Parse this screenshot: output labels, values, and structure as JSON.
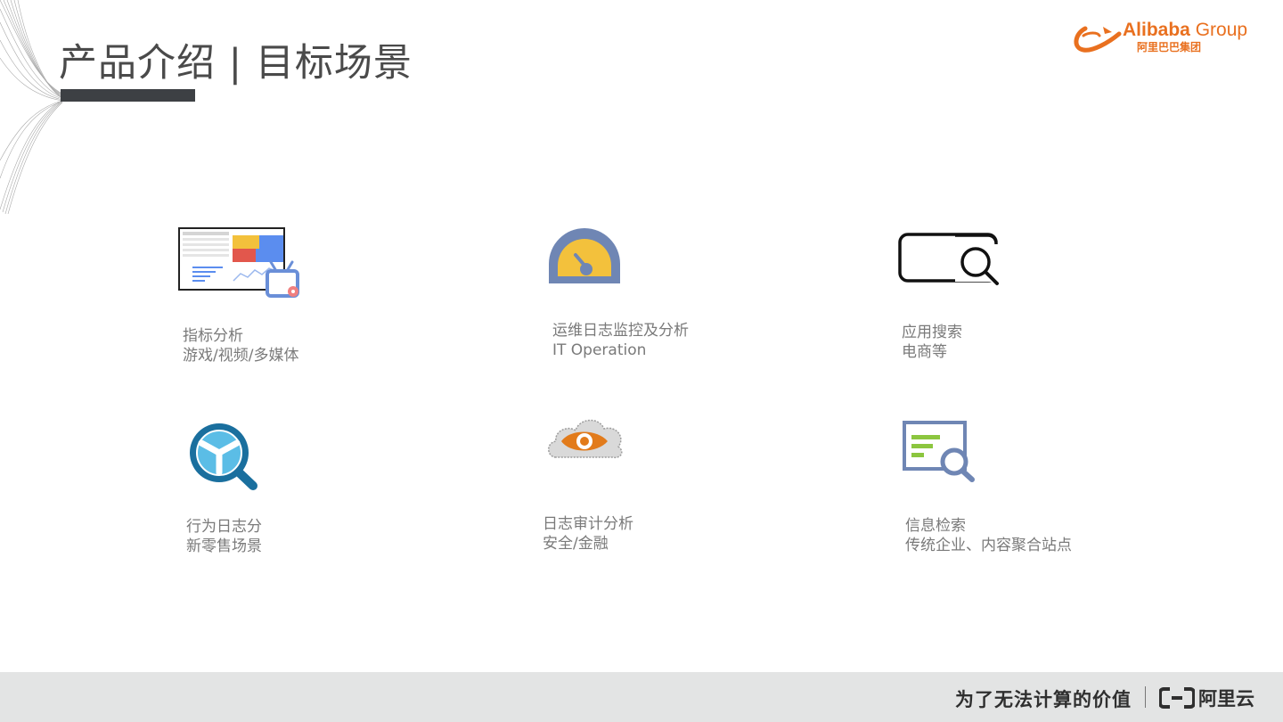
{
  "slide": {
    "title": "产品介绍 | 目标场景"
  },
  "logo": {
    "brand_en": "Alibaba",
    "group_en": "Group",
    "brand_cn": "阿里巴巴集团",
    "color": "#e9701f"
  },
  "scenarios": [
    {
      "icon": "dashboard-tv-icon",
      "line1": "指标分析",
      "line2": "游戏/视频/多媒体"
    },
    {
      "icon": "gauge-icon",
      "line1": "运维日志监控及分析",
      "line2": "IT Operation"
    },
    {
      "icon": "search-box-icon",
      "line1": "应用搜索",
      "line2": "电商等"
    },
    {
      "icon": "magnifier-icon",
      "line1": "行为日志分",
      "line2": "新零售场景"
    },
    {
      "icon": "cloud-eye-icon",
      "line1": "日志审计分析",
      "line2": "安全/金融"
    },
    {
      "icon": "document-search-icon",
      "line1": "信息检索",
      "line2": "传统企业、内容聚合站点"
    }
  ],
  "footer": {
    "slogan": "为了无法计算的价值",
    "brand": "阿里云"
  },
  "colors": {
    "title": "#4a4a4a",
    "label": "#7a7a7a",
    "footer_bg": "#e3e4e4",
    "gauge_blue": "#6f86b4",
    "gauge_yellow": "#f3c13c",
    "magnifier_blue": "#1a6f9e",
    "eye_orange": "#e27b1b",
    "doc_green": "#8cc63f"
  }
}
